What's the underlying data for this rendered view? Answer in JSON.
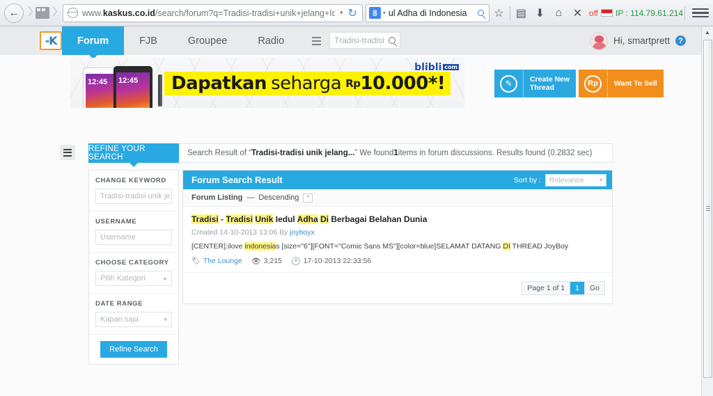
{
  "browser": {
    "back_icon": "back-arrow-icon",
    "tabgroup_icon": "tab-group-icon",
    "url_prefix": "www.",
    "url_domain": "kaskus.co.id",
    "url_path": "/search/forum?q=Tradisi-tradisi+unik+jelang+Idul",
    "url_dropdown_caret": "▾",
    "reload_icon": "↻",
    "search_engine_letter": "8",
    "search_query": "ul Adha di Indonesia",
    "bookmark_icon": "☆",
    "reader_icon": "▤",
    "download_icon": "⬇",
    "home_icon": "⌂",
    "close_icon": "✕",
    "proxy_status": "off",
    "ip_label": "IP : 114.79.61.214",
    "menu_icon": "hamburger-menu-icon"
  },
  "kaskus_nav": {
    "logo_text": "K",
    "tabs": [
      {
        "label": "Forum",
        "active": true
      },
      {
        "label": "FJB",
        "active": false
      },
      {
        "label": "Groupee",
        "active": false
      },
      {
        "label": "Radio",
        "active": false
      }
    ],
    "search_placeholder": "Tradisi-tradisi",
    "greeting": "Hi, smartprett",
    "help_badge": "?"
  },
  "banner": {
    "word1": "Dapatkan",
    "word2": "seharga",
    "currency": "Rp",
    "price": "10.000*!",
    "brand": "blibli",
    "brand_suffix": "com",
    "phone_time": "12:45"
  },
  "actions": {
    "create_thread": {
      "label": "Create New\nThread",
      "icon": "pencil-icon",
      "glyph": "✎",
      "color": "#2CA8E0"
    },
    "want_to_sell": {
      "label": "Want To Sell",
      "icon": "rupiah-icon",
      "glyph": "Rp",
      "color": "#F28E1C"
    }
  },
  "summary": {
    "refine_tab_label": "REFINE YOUR SEARCH",
    "text_before": "Search Result of “",
    "query": "Tradisi-tradisi unik jelang...",
    "text_middle": "” We found ",
    "count": "1",
    "text_after": " items in forum discussions. Results found (0.2832 sec)"
  },
  "sidebar": {
    "filters": [
      {
        "label": "CHANGE KEYWORD",
        "value": "Tradisi-tradisi unik je",
        "type": "text"
      },
      {
        "label": "USERNAME",
        "value": "Username",
        "type": "text"
      },
      {
        "label": "CHOOSE CATEGORY",
        "value": "Pilih Kategori",
        "type": "select",
        "arrow": "▸"
      },
      {
        "label": "DATE RANGE",
        "value": "Kapan saja",
        "type": "select",
        "arrow": "▾"
      }
    ],
    "refine_button": "Refine Search"
  },
  "results": {
    "panel_title": "Forum Search Result",
    "sort_by_label": "Sort by :",
    "sort_by_value": "Relevance",
    "sort_caret": "▾",
    "listing_label": "Forum Listing",
    "listing_dash": "—",
    "listing_order": "Descending",
    "collapse_glyph": "⌃",
    "item": {
      "title_parts": [
        {
          "text": "Tradisi",
          "highlight": true
        },
        {
          "text": " - ",
          "highlight": false
        },
        {
          "text": "Tradisi",
          "highlight": true
        },
        {
          "text": " ",
          "highlight": false
        },
        {
          "text": "Unik",
          "highlight": true
        },
        {
          "text": " ",
          "highlight": false
        },
        {
          "text": "Iedul",
          "highlight": false
        },
        {
          "text": " ",
          "highlight": false
        },
        {
          "text": "Adha",
          "highlight": true
        },
        {
          "text": " ",
          "highlight": false
        },
        {
          "text": "Di",
          "highlight": true
        },
        {
          "text": " Berbagai Belahan Dunia",
          "highlight": false
        }
      ],
      "created_prefix": "Created ",
      "created_date": "14-10-2013 13:06",
      "created_by": " By ",
      "author": "joyboyx",
      "snippet_parts": [
        {
          "text": "[CENTER]:ilove ",
          "highlight": false
        },
        {
          "text": "indonesia",
          "highlight": true
        },
        {
          "text": "s [size=\"6\"][FONT=\"Comic Sans MS\"][color=blue]SELAMAT DATANG ",
          "highlight": false
        },
        {
          "text": "DI",
          "highlight": true
        },
        {
          "text": " THREAD JoyBoy",
          "highlight": false
        }
      ],
      "category": "The Lounge",
      "views": "3,215",
      "last_post": "17-10-2013 22:33:56",
      "tag_glyph": "🏷",
      "eye_glyph": "👁",
      "clock_glyph": "🕐"
    },
    "pager": {
      "page_label": "Page 1 of 1",
      "current_page": "1",
      "go_label": "Go"
    }
  },
  "scrollbar": {
    "up_arrow": "▲"
  },
  "colors": {
    "accent_blue": "#29A9E1",
    "orange": "#F28E1C",
    "highlight_yellow": "#FFF47F",
    "link_blue": "#3E8FD0"
  }
}
